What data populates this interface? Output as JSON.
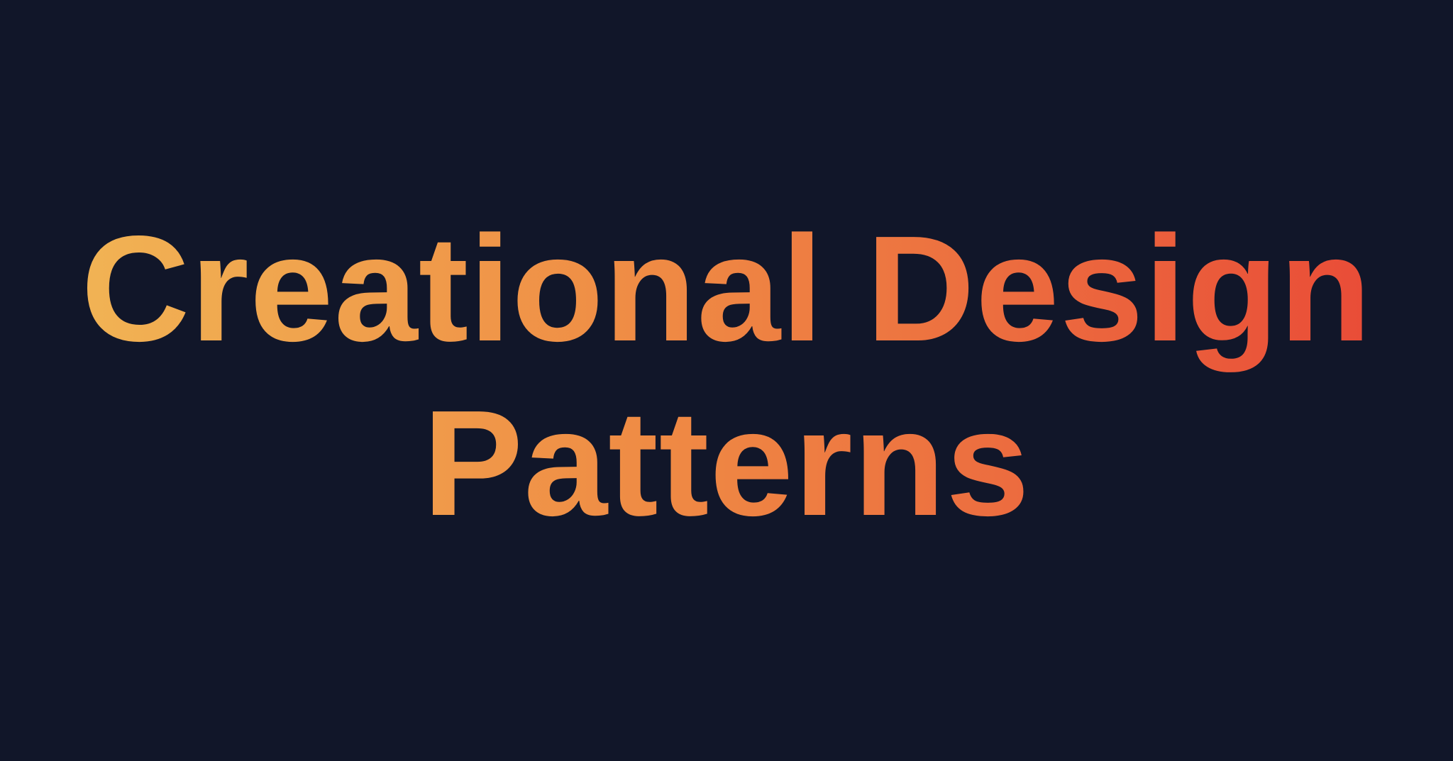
{
  "slide": {
    "background_color": "#111629",
    "title_lines": [
      "Creational Design",
      "Patterns"
    ],
    "gradient_colors": [
      "#f1b354",
      "#ef8a44",
      "#ec6c3f",
      "#e94c37"
    ]
  }
}
